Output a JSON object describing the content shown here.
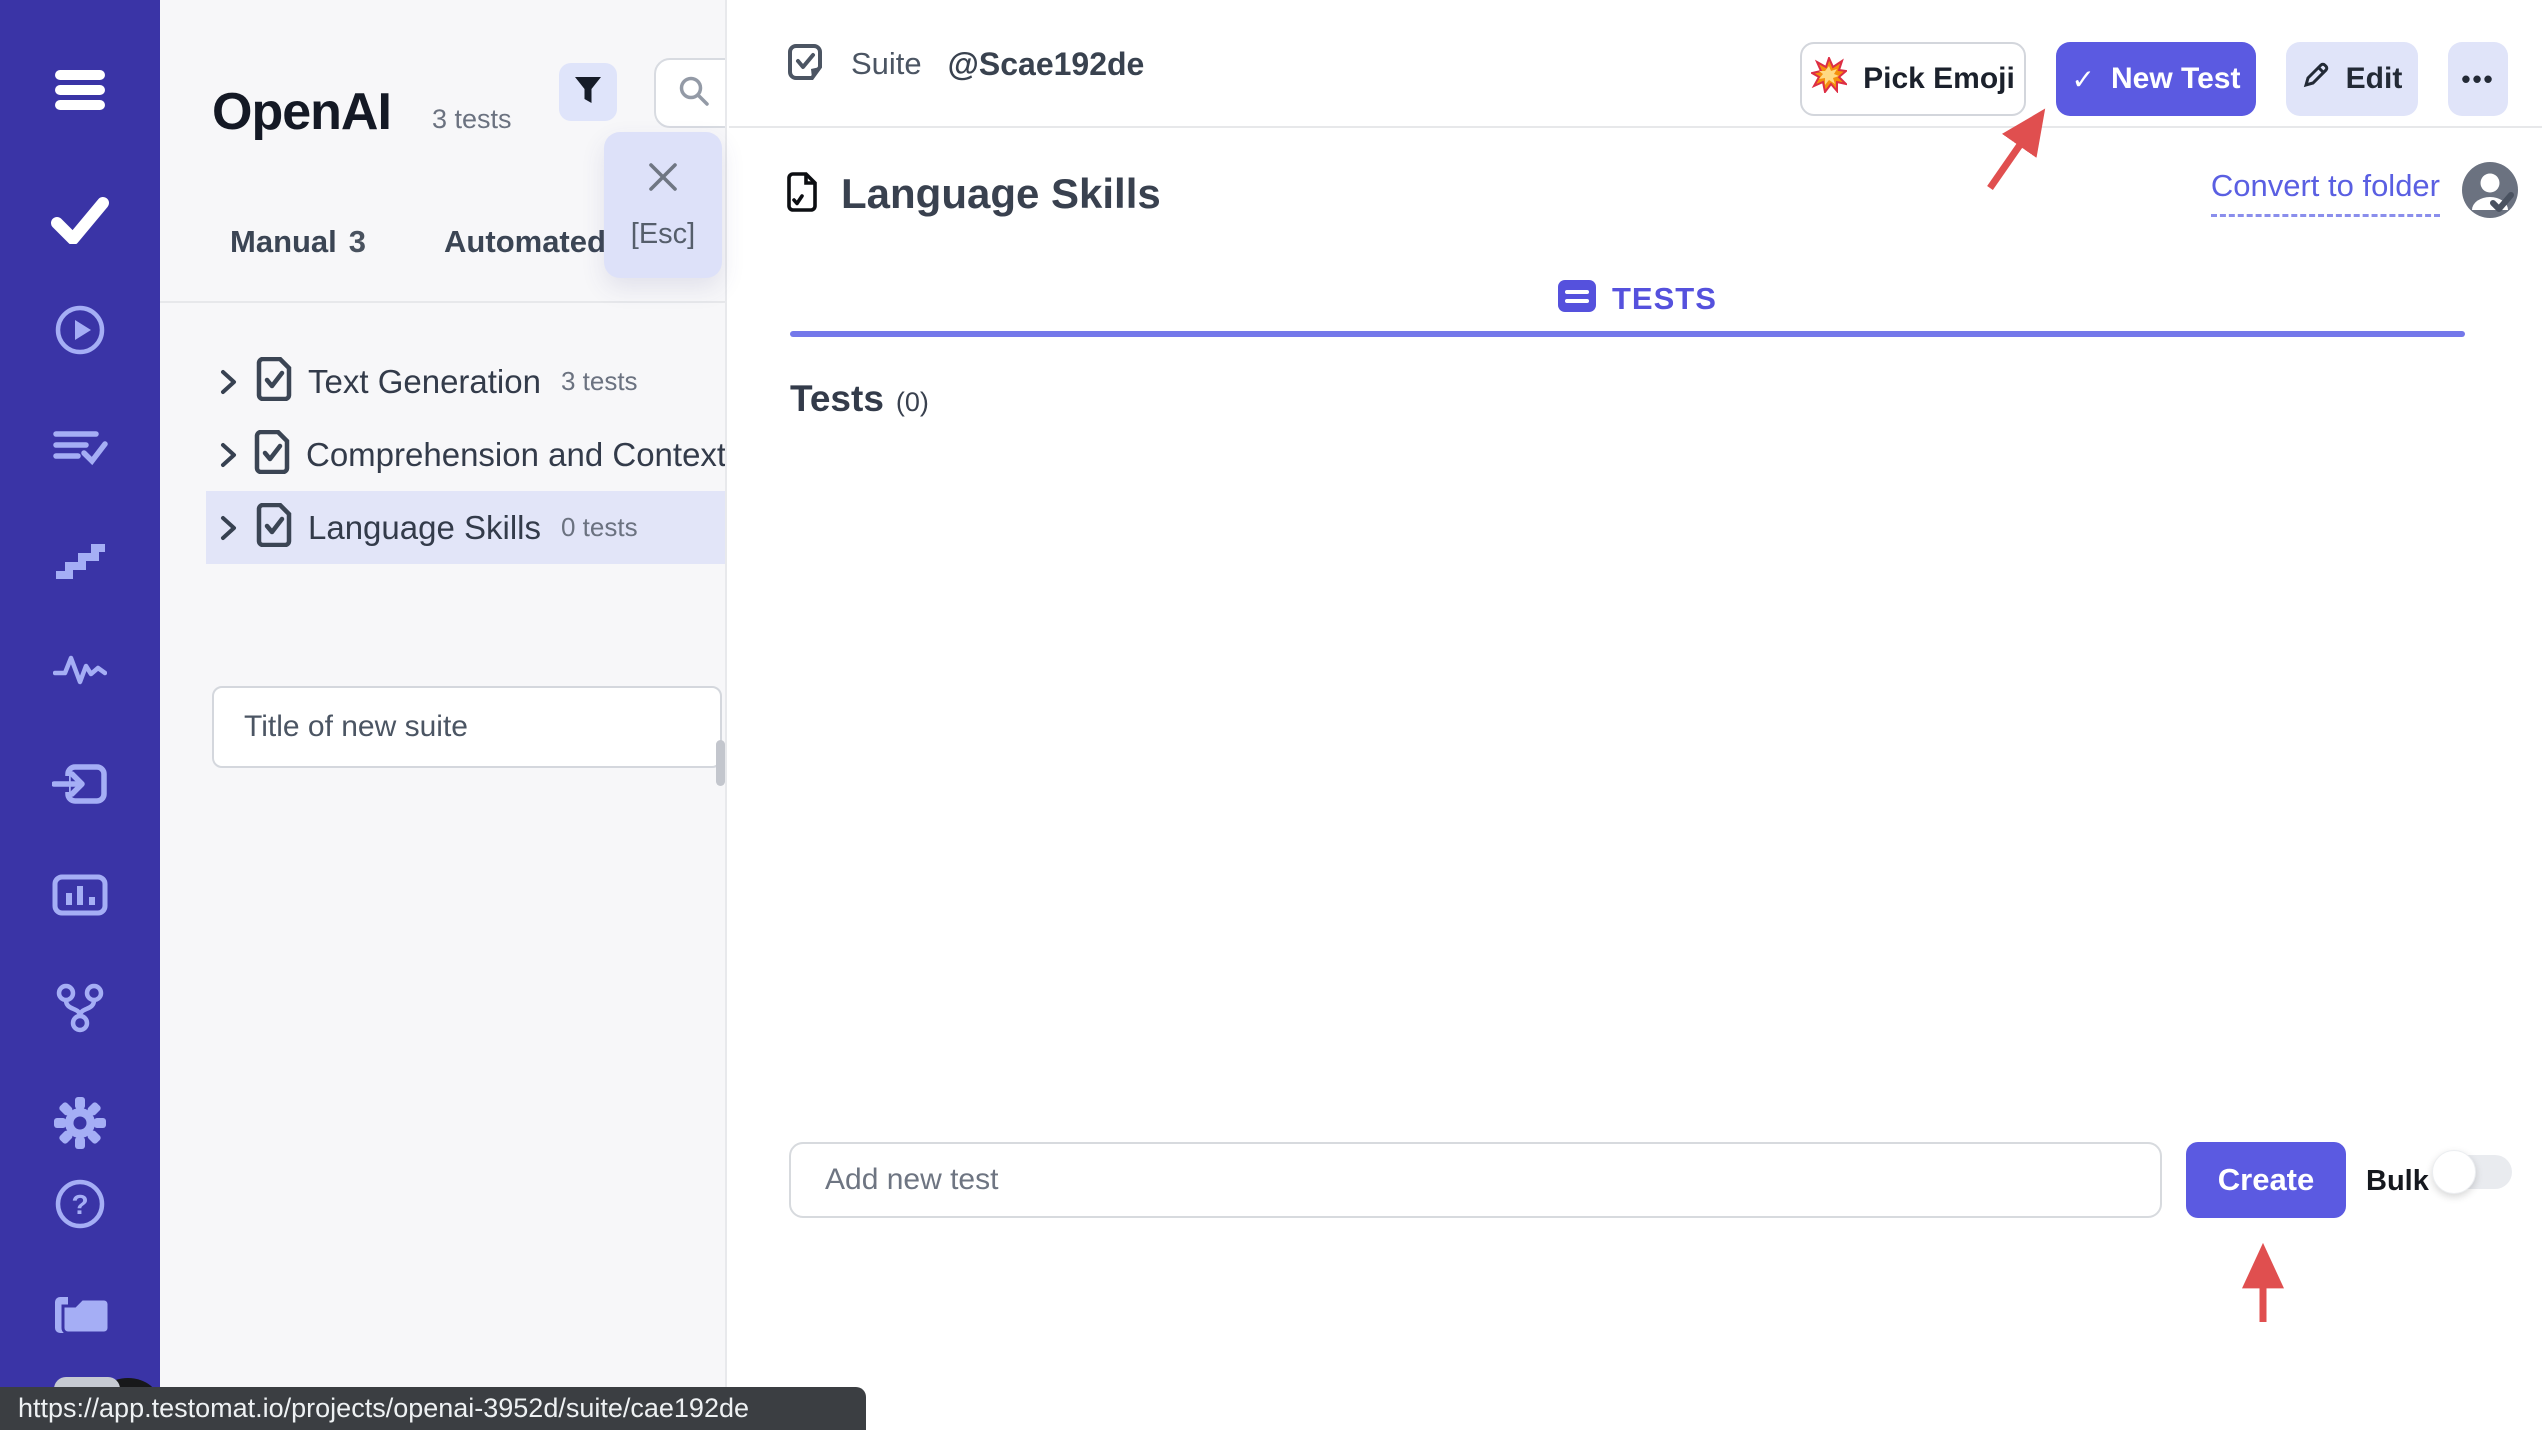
{
  "colors": {
    "accent": "#5b5ae1",
    "sidebar_bg": "#3a34a6",
    "sidebar_icon": "#a5aef5",
    "selected_row_bg": "#e2e5f8",
    "light_button_bg": "#e0e4f9",
    "link": "#5a5fe2",
    "tests_underline": "#7478ea",
    "annotation_red": "#e04f4f",
    "statusbar_bg": "#3b3e42"
  },
  "sidebar": {
    "icons": [
      "menu",
      "check",
      "play-circle",
      "test-runs",
      "steps",
      "pulse",
      "sign-in",
      "report",
      "branch",
      "settings",
      "help",
      "folder"
    ]
  },
  "panel": {
    "project_title": "OpenAI",
    "tests_count": "3 tests",
    "filter_popover": {
      "close_glyph": "×",
      "label": "[Esc]"
    },
    "tabs": [
      {
        "label": "Manual",
        "count": "3"
      },
      {
        "label": "Automated",
        "count": ""
      }
    ],
    "tree": [
      {
        "name": "Text Generation",
        "count": "3 tests"
      },
      {
        "name": "Comprehension and Context",
        "count": ""
      },
      {
        "name": "Language Skills",
        "count": "0 tests"
      }
    ],
    "new_suite_placeholder": "Title of new suite"
  },
  "main": {
    "suite_label": "Suite",
    "suite_id": "@Scae192de",
    "actions": {
      "pick_emoji": "Pick Emoji",
      "pick_emoji_icon": "💥",
      "new_test": "New Test",
      "new_test_check": "✓",
      "edit": "Edit",
      "more": "•••"
    },
    "title": "Language Skills",
    "convert_link": "Convert to folder",
    "tab_label": "TESTS",
    "tests_heading": "Tests",
    "tests_count": "(0)",
    "add_test_placeholder": "Add new test",
    "create_label": "Create",
    "bulk_label": "Bulk"
  },
  "statusbar": {
    "url": "https://app.testomat.io/projects/openai-3952d/suite/cae192de"
  }
}
